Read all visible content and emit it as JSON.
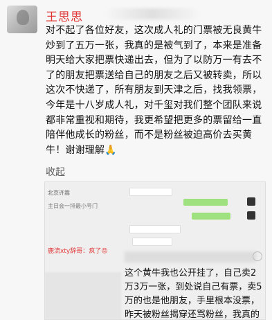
{
  "post": {
    "author_name": "王思思",
    "body": "对不起了各位好友，这次成人礼的门票被无良黄牛炒到了五万一张，我真的是被气到了，本来是准备明天给大家把票快递出去，但为了以防万一有去不了的朋友把票送给自己的朋友之后又被转卖，所以这次不快递了，所有朋友到天津之后，找我领票，今年是十八岁成人礼，对千玺对我们整个团队来说都非常重视和期待，我更希望把更多的票留给一直陪伴他成长的粉丝，而不是粉丝被迫高价去买黄牛！谢谢理解🙏",
    "fold_label": "收起"
  },
  "screenshot": {
    "chat_lines": [
      {
        "name": "北京许嵩",
        "text": ""
      },
      {
        "name": "",
        "text": "主日会一排最小号门"
      },
      {
        "name": "",
        "text": ""
      },
      {
        "name": "",
        "text": ""
      },
      {
        "name": "",
        "text": ""
      },
      {
        "name": "",
        "text": ""
      }
    ],
    "chat_msg_name": "鹿流xty辞哥：",
    "chat_msg_text": "疯了😡",
    "quote": "这个黄牛我也公开挂了，自己卖2万3万一张，到处说自己有票，卖5万的也是他朋友，手里根本没票，昨天被粉丝揭穿还骂粉丝，我真的心疼粉丝心疼的要死！"
  }
}
